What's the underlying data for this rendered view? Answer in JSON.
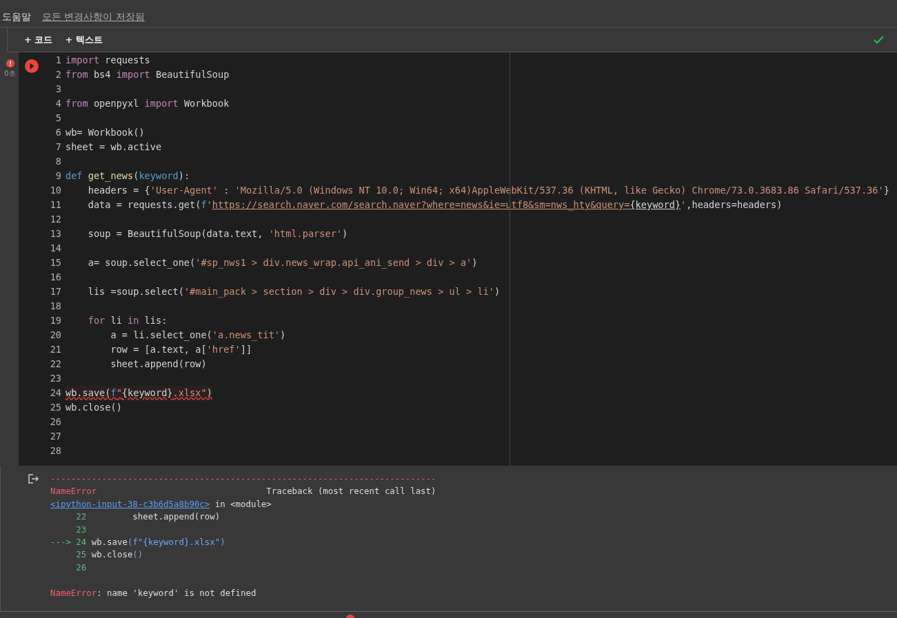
{
  "menu": {
    "help": "도움말",
    "save_status": "모든 변경사항이 저장됨"
  },
  "toolbar": {
    "buttons": [
      "+ 코드",
      "+ 텍스트"
    ],
    "connected": true
  },
  "cell": {
    "error": true,
    "time": "0초",
    "lines": [
      {
        "number": "1",
        "tokens": [
          {
            "kind": "kw",
            "text": "import"
          },
          {
            "kind": "plain",
            "text": " requests"
          }
        ]
      },
      {
        "number": "2",
        "tokens": [
          {
            "kind": "kw",
            "text": "from"
          },
          {
            "kind": "plain",
            "text": " bs4 "
          },
          {
            "kind": "kw",
            "text": "import"
          },
          {
            "kind": "plain",
            "text": " BeautifulSoup"
          }
        ]
      },
      {
        "number": "3"
      },
      {
        "number": "4",
        "tokens": [
          {
            "kind": "kw",
            "text": "from"
          },
          {
            "kind": "plain",
            "text": " openpyxl "
          },
          {
            "kind": "kw",
            "text": "import"
          },
          {
            "kind": "plain",
            "text": " Workbook"
          }
        ]
      },
      {
        "number": "5"
      },
      {
        "number": "6",
        "tokens": [
          {
            "kind": "plain",
            "text": "wb= Workbook()"
          }
        ]
      },
      {
        "number": "7",
        "tokens": [
          {
            "kind": "plain",
            "text": "sheet = wb.active"
          }
        ]
      },
      {
        "number": "8"
      },
      {
        "number": "9",
        "tokens": [
          {
            "kind": "def",
            "text": "def"
          },
          {
            "kind": "fn",
            "text": " get_news"
          },
          {
            "kind": "plain",
            "text": "("
          },
          {
            "kind": "def",
            "text": "keyword"
          },
          {
            "kind": "plain",
            "text": "):"
          }
        ]
      },
      {
        "number": "10",
        "tokens": [
          {
            "kind": "plain",
            "text": "    headers = {"
          },
          {
            "kind": "str",
            "text": "'User-Agent'"
          },
          {
            "kind": "plain",
            "text": " : "
          },
          {
            "kind": "str",
            "text": "'Mozilla/5.0 (Windows NT 10.0; Win64; x64)AppleWebKit/537.36 (KHTML, like Gecko) Chrome/73.0.3683.86 Safari/537.36'"
          },
          {
            "kind": "plain",
            "text": "}"
          }
        ]
      },
      {
        "number": "11",
        "tokens": [
          {
            "kind": "plain",
            "text": "    data = requests.get("
          },
          {
            "kind": "def",
            "text": "f"
          },
          {
            "kind": "str",
            "text": "'"
          },
          {
            "kind": "url",
            "text": "https://search.naver.com/search.naver?where=news&ie=utf8&sm=nws_hty&query="
          },
          {
            "kind": "urlvar",
            "text": "{keyword}"
          },
          {
            "kind": "str",
            "text": "'"
          },
          {
            "kind": "plain",
            "text": ",headers=headers)"
          }
        ]
      },
      {
        "number": "12"
      },
      {
        "number": "13",
        "tokens": [
          {
            "kind": "plain",
            "text": "    soup = BeautifulSoup(data.text, "
          },
          {
            "kind": "str",
            "text": "'html.parser'"
          },
          {
            "kind": "plain",
            "text": ")"
          }
        ]
      },
      {
        "number": "14"
      },
      {
        "number": "15",
        "tokens": [
          {
            "kind": "plain",
            "text": "    a= soup.select_one("
          },
          {
            "kind": "str",
            "text": "'#sp_nws1 > div.news_wrap.api_ani_send > div > a'"
          },
          {
            "kind": "plain",
            "text": ")"
          }
        ]
      },
      {
        "number": "16"
      },
      {
        "number": "17",
        "tokens": [
          {
            "kind": "plain",
            "text": "    lis =soup.select("
          },
          {
            "kind": "str",
            "text": "'#main_pack > section > div > div.group_news > ul > li'"
          },
          {
            "kind": "plain",
            "text": ")"
          }
        ]
      },
      {
        "number": "18"
      },
      {
        "number": "19",
        "tokens": [
          {
            "kind": "kw",
            "text": "    for"
          },
          {
            "kind": "plain",
            "text": " li "
          },
          {
            "kind": "kw",
            "text": "in"
          },
          {
            "kind": "plain",
            "text": " lis:"
          }
        ]
      },
      {
        "number": "20",
        "tokens": [
          {
            "kind": "plain",
            "text": "        a = li.select_one("
          },
          {
            "kind": "str",
            "text": "'a.news_tit'"
          },
          {
            "kind": "plain",
            "text": ")"
          }
        ]
      },
      {
        "number": "21",
        "tokens": [
          {
            "kind": "plain",
            "text": "        row = [a.text, a["
          },
          {
            "kind": "str",
            "text": "'href'"
          },
          {
            "kind": "plain",
            "text": "]]"
          }
        ]
      },
      {
        "number": "22",
        "tokens": [
          {
            "kind": "plain",
            "text": "        sheet.append(row)"
          }
        ]
      },
      {
        "number": "23"
      },
      {
        "number": "24",
        "error": true,
        "tokens": [
          {
            "kind": "plain",
            "text": "wb.save("
          },
          {
            "kind": "def",
            "text": "f"
          },
          {
            "kind": "str",
            "text": "\""
          },
          {
            "kind": "plain",
            "text": "{keyword}"
          },
          {
            "kind": "str",
            "text": ".xlsx\""
          },
          {
            "kind": "plain",
            "text": ")"
          }
        ]
      },
      {
        "number": "25",
        "tokens": [
          {
            "kind": "plain",
            "text": "wb.close()"
          }
        ]
      },
      {
        "number": "26"
      },
      {
        "number": "27"
      },
      {
        "number": "28"
      }
    ]
  },
  "output": {
    "lines": [
      [
        {
          "kind": "red",
          "text": "---------------------------------------------------------------------------"
        }
      ],
      [
        {
          "kind": "red",
          "text": "NameError"
        },
        {
          "kind": "plain",
          "text": "                                 Traceback (most recent call last)"
        }
      ],
      [
        {
          "kind": "link",
          "text": "<ipython-input-38-c3b6d5a8b90c>"
        },
        {
          "kind": "plain",
          "text": " in <module>"
        }
      ],
      [
        {
          "kind": "green",
          "text": "     22"
        },
        {
          "kind": "plain",
          "text": "         sheet.append(row)"
        }
      ],
      [
        {
          "kind": "green",
          "text": "     23"
        }
      ],
      [
        {
          "kind": "green",
          "text": "---> 24"
        },
        {
          "kind": "plain",
          "text": " wb.save"
        },
        {
          "kind": "blue",
          "text": "(f\"{keyword}.xlsx\")"
        }
      ],
      [
        {
          "kind": "green",
          "text": "     25"
        },
        {
          "kind": "plain",
          "text": " wb.close"
        },
        {
          "kind": "blue",
          "text": "()"
        }
      ],
      [
        {
          "kind": "green",
          "text": "     26"
        }
      ]
    ],
    "message": [
      {
        "kind": "red",
        "text": "NameError"
      },
      {
        "kind": "plain",
        "text": ": name 'keyword' is not defined"
      }
    ]
  },
  "status_bar": {
    "error": true
  }
}
